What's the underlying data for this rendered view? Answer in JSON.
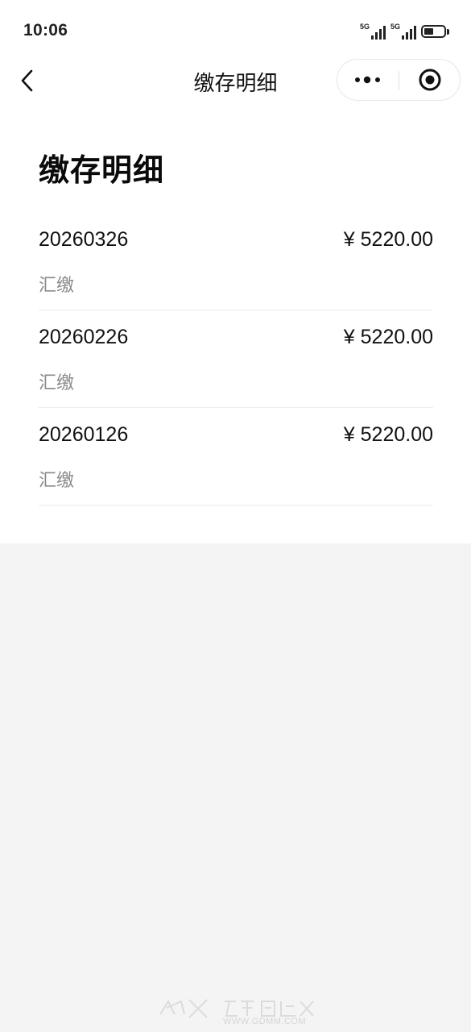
{
  "status_bar": {
    "time": "10:06",
    "signal1_label": "5G",
    "signal2_label": "5G",
    "icons": [
      "signal-5g-icon",
      "signal-5g-icon",
      "battery-icon"
    ]
  },
  "nav": {
    "title": "缴存明细",
    "back_icon": "chevron-left-icon",
    "more_icon": "more-dots-icon",
    "close_icon": "target-circle-icon"
  },
  "page": {
    "heading": "缴存明细"
  },
  "records": [
    {
      "date": "20260326",
      "amount": "¥ 5220.00",
      "type": "汇缴"
    },
    {
      "date": "20260226",
      "amount": "¥ 5220.00",
      "type": "汇缴"
    },
    {
      "date": "20260126",
      "amount": "¥ 5220.00",
      "type": "汇缴"
    }
  ],
  "watermark": {
    "url": "WWW.GDMM.COM"
  },
  "colors": {
    "content_bg": "#ffffff",
    "page_bg": "#f4f4f4",
    "text_primary": "#111111",
    "text_secondary": "#8a8a8a",
    "divider": "#ececec"
  }
}
